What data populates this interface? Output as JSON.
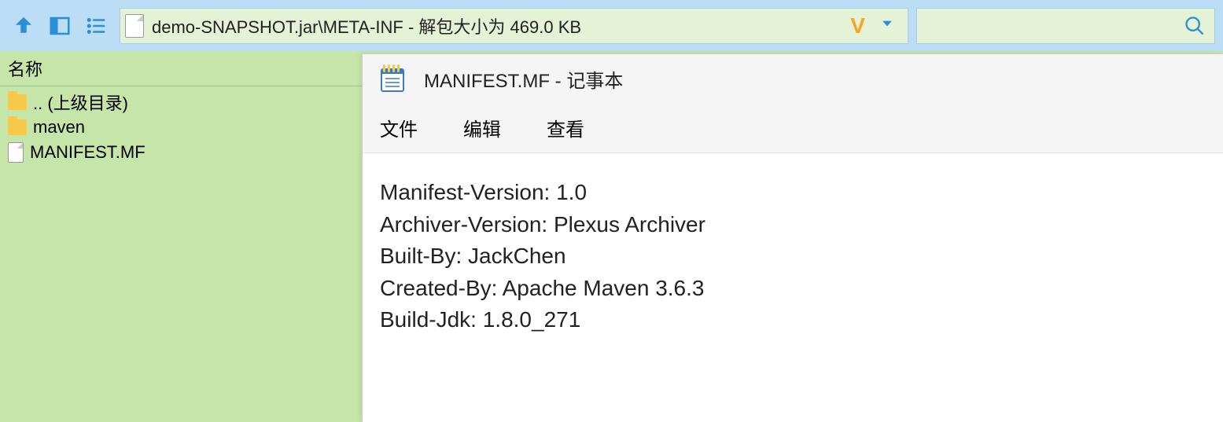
{
  "toolbar": {
    "address_text": "demo-SNAPSHOT.jar\\META-INF - 解包大小为 469.0 KB",
    "v_label": "V",
    "search_placeholder": ""
  },
  "file_list": {
    "column_header": "名称",
    "items": [
      {
        "type": "folder",
        "label": ".. (上级目录)"
      },
      {
        "type": "folder",
        "label": "maven"
      },
      {
        "type": "file",
        "label": "MANIFEST.MF"
      }
    ]
  },
  "notepad": {
    "title": "MANIFEST.MF - 记事本",
    "menu": {
      "file": "文件",
      "edit": "编辑",
      "view": "查看"
    },
    "lines": [
      "Manifest-Version: 1.0",
      "Archiver-Version: Plexus Archiver",
      "Built-By: JackChen",
      "Created-By: Apache Maven 3.6.3",
      "Build-Jdk: 1.8.0_271"
    ]
  }
}
